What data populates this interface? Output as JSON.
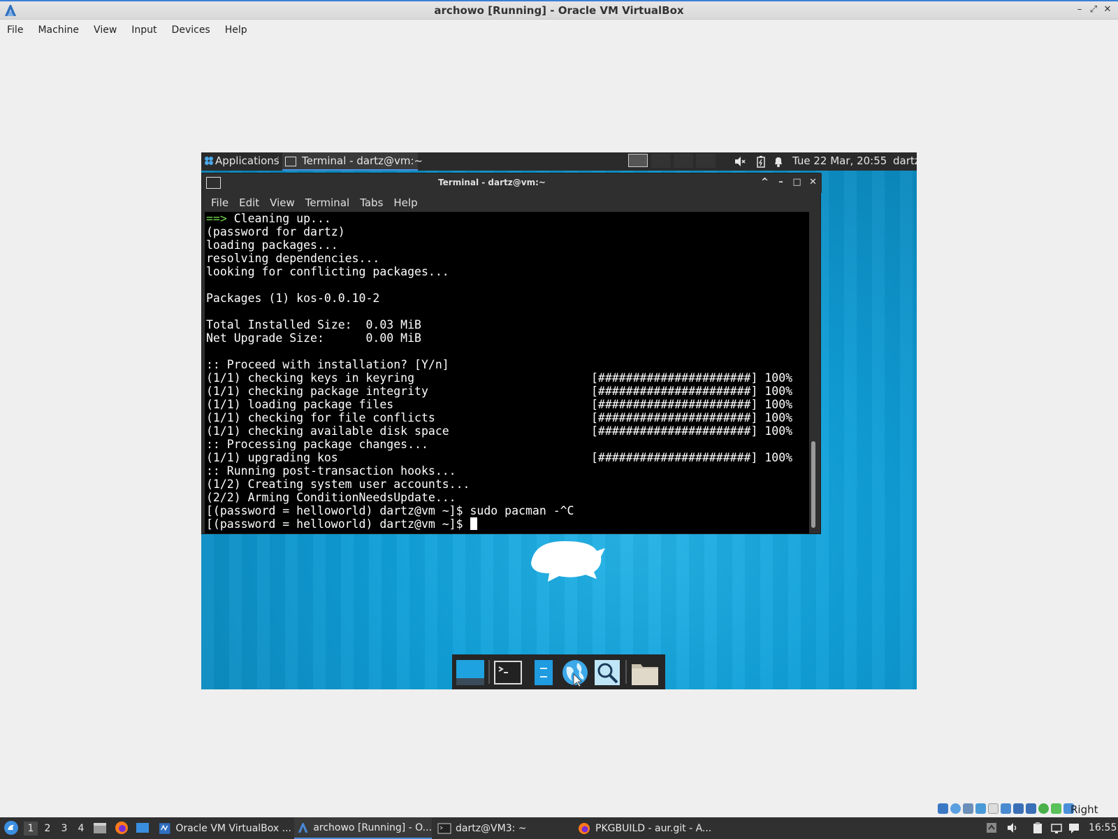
{
  "host": {
    "title": "archowo [Running] - Oracle VM VirtualBox",
    "window_buttons": [
      "–",
      "⤢",
      "✕"
    ],
    "menu": [
      "File",
      "Machine",
      "View",
      "Input",
      "Devices",
      "Help"
    ],
    "status_label": "Right Ctrl",
    "status_icons": [
      "hard-disk-icon",
      "optical-disk-icon",
      "audio-icon",
      "network-icon",
      "usb-icon",
      "shared-folder-icon",
      "display-icon",
      "recording-icon",
      "virtualization-icon",
      "mouse-integration-icon",
      "keyboard-icon"
    ]
  },
  "guest_panel": {
    "applications_label": "Applications",
    "task_label": "Terminal - dartz@vm:~",
    "clock": "Tue 22 Mar, 20:55",
    "user": "dartz"
  },
  "terminal": {
    "title": "Terminal - dartz@vm:~",
    "window_buttons": [
      "^",
      "–",
      "□",
      "✕"
    ],
    "menu": [
      "File",
      "Edit",
      "View",
      "Terminal",
      "Tabs",
      "Help"
    ],
    "lines": [
      {
        "prefix": "==>",
        "text": " Cleaning up...",
        "progress": ""
      },
      {
        "prefix": "",
        "text": "(password for dartz)",
        "progress": ""
      },
      {
        "prefix": "",
        "text": "loading packages...",
        "progress": ""
      },
      {
        "prefix": "",
        "text": "resolving dependencies...",
        "progress": ""
      },
      {
        "prefix": "",
        "text": "looking for conflicting packages...",
        "progress": ""
      },
      {
        "prefix": "",
        "text": "",
        "progress": ""
      },
      {
        "prefix": "",
        "text": "Packages (1) kos-0.0.10-2",
        "progress": ""
      },
      {
        "prefix": "",
        "text": "",
        "progress": ""
      },
      {
        "prefix": "",
        "text": "Total Installed Size:  0.03 MiB",
        "progress": ""
      },
      {
        "prefix": "",
        "text": "Net Upgrade Size:      0.00 MiB",
        "progress": ""
      },
      {
        "prefix": "",
        "text": "",
        "progress": ""
      },
      {
        "prefix": "",
        "text": ":: Proceed with installation? [Y/n]",
        "progress": ""
      },
      {
        "prefix": "",
        "text": "(1/1) checking keys in keyring",
        "progress": "[######################] 100%"
      },
      {
        "prefix": "",
        "text": "(1/1) checking package integrity",
        "progress": "[######################] 100%"
      },
      {
        "prefix": "",
        "text": "(1/1) loading package files",
        "progress": "[######################] 100%"
      },
      {
        "prefix": "",
        "text": "(1/1) checking for file conflicts",
        "progress": "[######################] 100%"
      },
      {
        "prefix": "",
        "text": "(1/1) checking available disk space",
        "progress": "[######################] 100%"
      },
      {
        "prefix": "",
        "text": ":: Processing package changes...",
        "progress": ""
      },
      {
        "prefix": "",
        "text": "(1/1) upgrading kos",
        "progress": "[######################] 100%"
      },
      {
        "prefix": "",
        "text": ":: Running post-transaction hooks...",
        "progress": ""
      },
      {
        "prefix": "",
        "text": "(1/2) Creating system user accounts...",
        "progress": ""
      },
      {
        "prefix": "",
        "text": "(2/2) Arming ConditionNeedsUpdate...",
        "progress": ""
      },
      {
        "prefix": "",
        "text": "[(password = helloworld) dartz@vm ~]$ sudo pacman -^C",
        "progress": ""
      },
      {
        "prefix": "",
        "text": "[(password = helloworld) dartz@vm ~]$ ",
        "progress": ""
      }
    ]
  },
  "dock": {
    "items": [
      "show-desktop-icon",
      "terminal-icon",
      "file-manager-icon",
      "web-browser-icon",
      "app-finder-icon",
      "folder-icon"
    ]
  },
  "taskbar": {
    "workspaces": [
      "1",
      "2",
      "3",
      "4"
    ],
    "tasks": [
      {
        "label": "Oracle VM VirtualBox ...",
        "icon": "virtualbox-icon"
      },
      {
        "label": "archowo [Running] - O...",
        "icon": "virtualbox-vm-icon"
      },
      {
        "label": "dartz@VM3: ~",
        "icon": "terminal-icon"
      },
      {
        "label": "PKGBUILD - aur.git - A...",
        "icon": "firefox-icon"
      }
    ],
    "time": "16:55"
  },
  "colors": {
    "accent": "#4a90d9",
    "prompt_arrow": "#74d94d",
    "desktop": "#0f9fd8",
    "panel": "#2b2b2b",
    "terminal_bg": "#000000"
  }
}
